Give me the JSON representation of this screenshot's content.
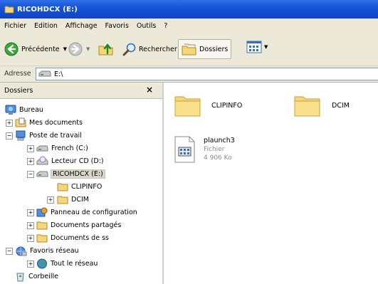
{
  "window": {
    "title": "RICOHDCX (E:)"
  },
  "menu": [
    "Fichier",
    "Edition",
    "Affichage",
    "Favoris",
    "Outils",
    "?"
  ],
  "toolbar": {
    "back_label": "Précédente",
    "search_label": "Rechercher",
    "folders_label": "Dossiers"
  },
  "address": {
    "label": "Adresse",
    "value": "E:\\"
  },
  "folders_pane": {
    "title": "Dossiers",
    "close": "×",
    "items": [
      {
        "label": "Bureau",
        "icon": "desktop-icon"
      },
      {
        "label": "Mes documents",
        "icon": "my-documents-icon",
        "expander": "+"
      },
      {
        "label": "Poste de travail",
        "icon": "computer-icon",
        "expander": "−"
      },
      {
        "label": "French (C:)",
        "icon": "drive-icon",
        "expander": "+"
      },
      {
        "label": "Lecteur CD (D:)",
        "icon": "cd-drive-icon",
        "expander": "+"
      },
      {
        "label": "RICOHDCX (E:)",
        "icon": "drive-icon",
        "expander": "−",
        "selected": true
      },
      {
        "label": "CLIPINFO",
        "icon": "folder-icon"
      },
      {
        "label": "DCIM",
        "icon": "folder-icon",
        "expander": "+"
      },
      {
        "label": "Panneau de configuration",
        "icon": "control-panel-icon",
        "expander": "+"
      },
      {
        "label": "Documents partagés",
        "icon": "folder-icon",
        "expander": "+"
      },
      {
        "label": "Documents de ss",
        "icon": "folder-icon",
        "expander": "+"
      },
      {
        "label": "Favoris réseau",
        "icon": "network-icon",
        "expander": "−"
      },
      {
        "label": "Tout le réseau",
        "icon": "globe-icon",
        "expander": "+"
      },
      {
        "label": "Corbeille",
        "icon": "recycle-bin-icon"
      }
    ]
  },
  "files": [
    {
      "name": "CLIPINFO",
      "icon": "folder-icon"
    },
    {
      "name": "DCIM",
      "icon": "folder-icon"
    },
    {
      "name": "plaunch3",
      "type": "Fichier",
      "size": "4 906 Ko",
      "icon": "file-icon"
    }
  ],
  "colors": {
    "titlebar": "#1552d6",
    "chrome": "#ece9d8",
    "folder": "#f5d678",
    "accent_green": "#3ba73b"
  }
}
